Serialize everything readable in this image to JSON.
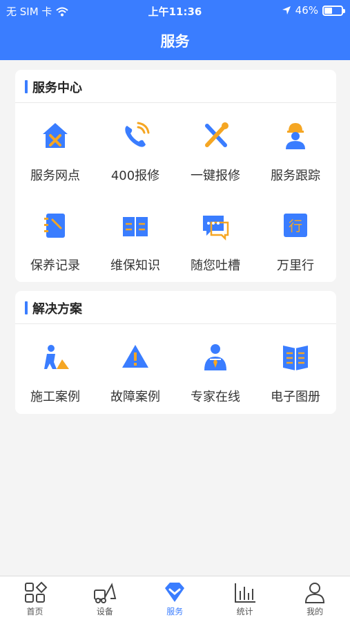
{
  "status_bar": {
    "carrier": "无 SIM 卡",
    "time": "上午11:36",
    "battery": "46%",
    "battery_level": 0.46
  },
  "header": {
    "title": "服务"
  },
  "sections": [
    {
      "title": "服务中心",
      "items": [
        {
          "label": "服务网点",
          "icon": "house-wrench-icon"
        },
        {
          "label": "400报修",
          "icon": "phone-icon"
        },
        {
          "label": "一键报修",
          "icon": "tools-icon"
        },
        {
          "label": "服务跟踪",
          "icon": "worker-icon"
        },
        {
          "label": "保养记录",
          "icon": "notebook-icon"
        },
        {
          "label": "维保知识",
          "icon": "book-icon"
        },
        {
          "label": "随您吐槽",
          "icon": "chat-icon"
        },
        {
          "label": "万里行",
          "icon": "xing-badge-icon"
        }
      ]
    },
    {
      "title": "解决方案",
      "items": [
        {
          "label": "施工案例",
          "icon": "construction-icon"
        },
        {
          "label": "故障案例",
          "icon": "warning-icon"
        },
        {
          "label": "专家在线",
          "icon": "expert-icon"
        },
        {
          "label": "电子图册",
          "icon": "manual-icon"
        }
      ]
    }
  ],
  "tabbar": {
    "active": "服务",
    "tabs": [
      {
        "label": "首页",
        "icon": "home-grid-icon"
      },
      {
        "label": "设备",
        "icon": "machine-icon"
      },
      {
        "label": "服务",
        "icon": "service-diamond-icon"
      },
      {
        "label": "统计",
        "icon": "bar-chart-icon"
      },
      {
        "label": "我的",
        "icon": "person-icon"
      }
    ]
  },
  "colors": {
    "brand": "#3a7dff",
    "accent": "#f5a623",
    "background": "#f4f4f4"
  }
}
